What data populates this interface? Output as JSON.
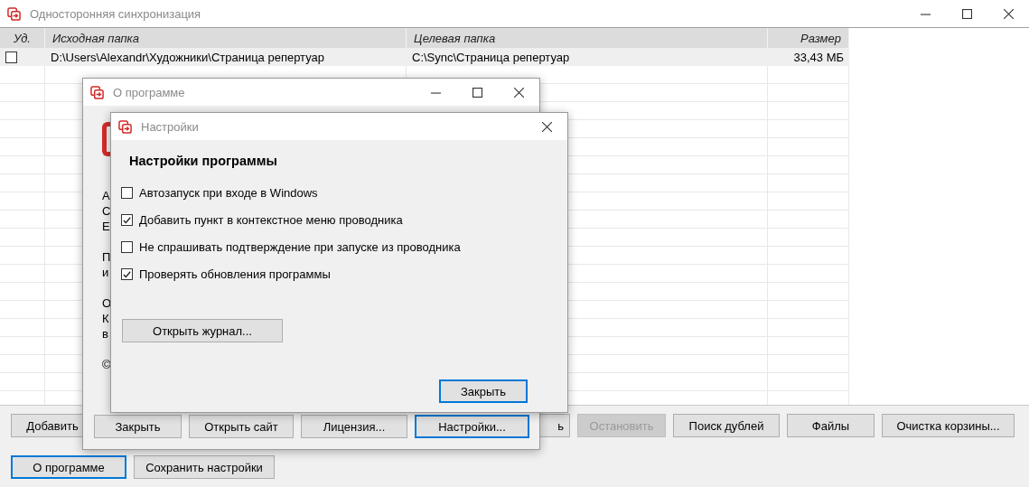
{
  "main_window": {
    "title": "Односторонняя синхронизация",
    "table": {
      "columns": [
        "Уд.",
        "Исходная папка",
        "Целевая папка",
        "Размер"
      ],
      "rows": [
        {
          "checked": false,
          "source": "D:\\Users\\Alexandr\\Художники\\Страница репертуар",
          "target": "C:\\Sync\\Страница репертуар",
          "size": "33,43 МБ"
        }
      ]
    },
    "buttons": [
      {
        "label": "Добавить",
        "disabled": false,
        "focused": false
      },
      {
        "label": "ь",
        "disabled": false,
        "focused": false
      },
      {
        "label": "Остановить",
        "disabled": true,
        "focused": false
      },
      {
        "label": "Поиск дублей",
        "disabled": false,
        "focused": false
      },
      {
        "label": "Файлы",
        "disabled": false,
        "focused": false
      },
      {
        "label": "Очистка корзины...",
        "disabled": false,
        "focused": false
      }
    ],
    "buttons_row_2": [
      {
        "label": "О программе",
        "disabled": false,
        "focused": true
      },
      {
        "label": "Сохранить настройки",
        "disabled": false,
        "focused": false
      }
    ]
  },
  "about_dialog": {
    "title": "О программе",
    "text_fragments": [
      [
        "А",
        "С",
        "Е"
      ],
      [
        "П",
        "и"
      ],
      [
        "О",
        "К",
        "в"
      ],
      [
        "©"
      ]
    ],
    "buttons": [
      {
        "label": "Закрыть",
        "disabled": false,
        "focused": false
      },
      {
        "label": "Открыть сайт",
        "disabled": false,
        "focused": false
      },
      {
        "label": "Лицензия...",
        "disabled": false,
        "focused": false
      },
      {
        "label": "Настройки...",
        "disabled": false,
        "focused": true
      }
    ]
  },
  "settings_dialog": {
    "title": "Настройки",
    "heading": "Настройки программы",
    "options": [
      {
        "label": "Автозапуск при входе в Windows",
        "checked": false
      },
      {
        "label": "Добавить пункт в контекстное меню проводника",
        "checked": true
      },
      {
        "label": "Не спрашивать подтверждение при запуске из проводника",
        "checked": false
      },
      {
        "label": "Проверять обновления программы",
        "checked": true
      }
    ],
    "log_button": {
      "label": "Открыть журнал...",
      "disabled": false,
      "focused": false
    },
    "close_button": {
      "label": "Закрыть",
      "disabled": false,
      "focused": true
    }
  }
}
